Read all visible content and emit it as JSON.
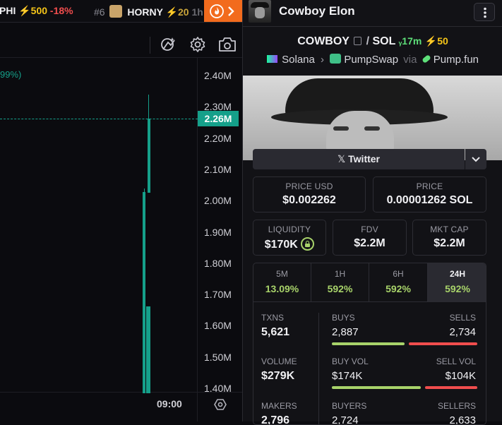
{
  "ticker": [
    {
      "symbol": "PHI",
      "boost": "⚡500",
      "change": "-18%"
    },
    {
      "rank": "#6",
      "symbol": "HORNY",
      "boost": "⚡20",
      "extra": "1h"
    }
  ],
  "chart": {
    "price_axis": [
      "2.40M",
      "2.30M",
      "2.20M",
      "2.10M",
      "2.00M",
      "1.90M",
      "1.80M",
      "1.70M",
      "1.60M",
      "1.50M",
      "1.40M"
    ],
    "current_price": "2.26M",
    "legend_fragment": "99%)",
    "time_label": "09:00"
  },
  "token": {
    "name": "Cowboy Elon",
    "symbol": "COWBOY",
    "separator": "/",
    "quote": "SOL",
    "age": "17m",
    "boost": "⚡50",
    "chain": "Solana",
    "dex": "PumpSwap",
    "via": "via",
    "launchpad": "Pump.fun",
    "twitter_label": "Twitter"
  },
  "prices": {
    "usd_label": "PRICE USD",
    "usd": "$0.002262",
    "native_label": "PRICE",
    "native": "0.00001262 SOL"
  },
  "metrics": {
    "liquidity_label": "LIQUIDITY",
    "liquidity": "$170K",
    "fdv_label": "FDV",
    "fdv": "$2.2M",
    "mcap_label": "MKT CAP",
    "mcap": "$2.2M"
  },
  "timeframes": [
    {
      "label": "5M",
      "change": "13.09%"
    },
    {
      "label": "1H",
      "change": "592%"
    },
    {
      "label": "6H",
      "change": "592%"
    },
    {
      "label": "24H",
      "change": "592%"
    }
  ],
  "stats": {
    "txns_label": "TXNS",
    "txns": "5,621",
    "buys_label": "BUYS",
    "buys": "2,887",
    "sells_label": "SELLS",
    "sells": "2,734",
    "buys_ratio": 0.514,
    "volume_label": "VOLUME",
    "volume": "$279K",
    "buyvol_label": "BUY VOL",
    "buyvol": "$174K",
    "sellvol_label": "SELL VOL",
    "sellvol": "$104K",
    "vol_ratio": 0.626,
    "makers_label": "MAKERS",
    "makers": "2,796",
    "buyers_label": "BUYERS",
    "buyers": "2,724",
    "sellers_label": "SELLERS",
    "sellers": "2,633"
  },
  "colors": {
    "green": "#5ee07a",
    "red": "#f04d4d",
    "teal": "#15a08a",
    "yellow": "#f5c518",
    "accent_orange": "#f26b1d"
  }
}
